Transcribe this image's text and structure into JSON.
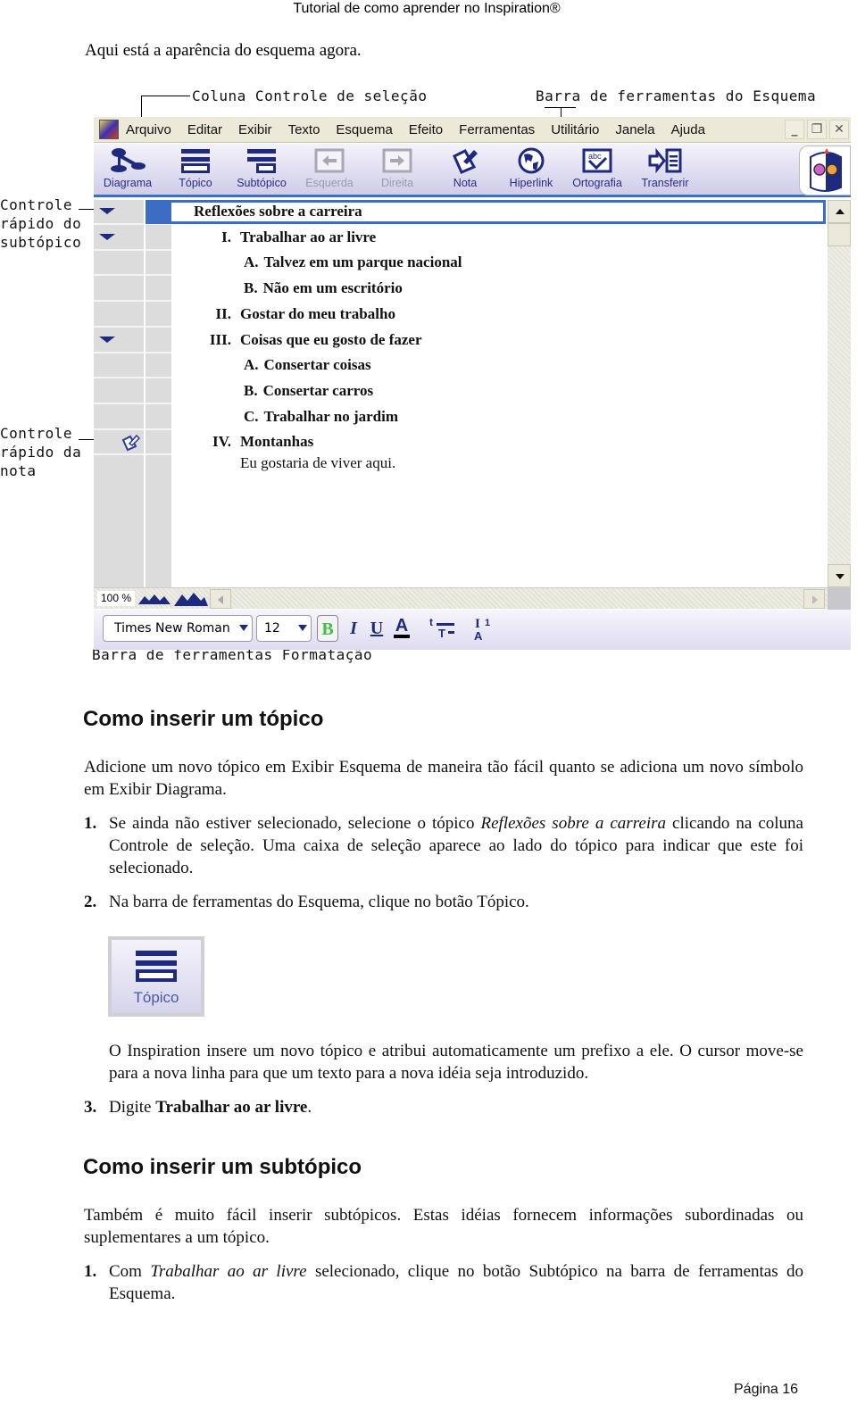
{
  "header": {
    "title": "Tutorial de como aprender no Inspiration®"
  },
  "intro": "Aqui está a aparência do esquema agora.",
  "figure": {
    "callouts": {
      "selection_column": "Coluna Controle de seleção",
      "outline_toolbar": "Barra de ferramentas do Esquema",
      "subtopic_quick_control": [
        "Controle",
        "rápido do",
        "subtópico"
      ],
      "note_quick_control": [
        "Controle",
        "rápido da",
        "nota"
      ],
      "formatting_toolbar": "Barra de ferramentas Formatação"
    },
    "app": {
      "menu": [
        "Arquivo",
        "Editar",
        "Exibir",
        "Texto",
        "Esquema",
        "Efeito",
        "Ferramentas",
        "Utilitário",
        "Janela",
        "Ajuda"
      ],
      "window_buttons": {
        "minimize": "_",
        "restore": "❐",
        "close": "✕"
      },
      "toolbar": [
        {
          "label": "Diagrama",
          "icon": "diagram-icon",
          "enabled": true
        },
        {
          "label": "Tópico",
          "icon": "topic-icon",
          "enabled": true
        },
        {
          "label": "Subtópico",
          "icon": "subtopic-icon",
          "enabled": true
        },
        {
          "label": "Esquerda",
          "icon": "arrow-left-icon",
          "enabled": false
        },
        {
          "label": "Direita",
          "icon": "arrow-right-icon",
          "enabled": false
        },
        {
          "label": "Nota",
          "icon": "note-icon",
          "enabled": true
        },
        {
          "label": "Hiperlink",
          "icon": "globe-icon",
          "enabled": true
        },
        {
          "label": "Ortografia",
          "icon": "spellcheck-icon",
          "enabled": true
        },
        {
          "label": "Transferir",
          "icon": "transfer-icon",
          "enabled": true
        }
      ],
      "outline": [
        {
          "prefix": "",
          "text": "Reflexões sobre a carreira",
          "level": 0,
          "selected": true,
          "control": "subtopic"
        },
        {
          "prefix": "I.",
          "text": "Trabalhar ao ar livre",
          "level": 1,
          "control": "subtopic"
        },
        {
          "prefix": "A.",
          "text": "Talvez em um parque nacional",
          "level": 2,
          "control": ""
        },
        {
          "prefix": "B.",
          "text": "Não em um escritório",
          "level": 2,
          "control": ""
        },
        {
          "prefix": "II.",
          "text": "Gostar do meu trabalho",
          "level": 1,
          "control": ""
        },
        {
          "prefix": "III.",
          "text": "Coisas que eu gosto de fazer",
          "level": 1,
          "control": "subtopic"
        },
        {
          "prefix": "A.",
          "text": "Consertar coisas",
          "level": 2,
          "control": ""
        },
        {
          "prefix": "B.",
          "text": "Consertar carros",
          "level": 2,
          "control": ""
        },
        {
          "prefix": "C.",
          "text": "Trabalhar no jardim",
          "level": 2,
          "control": ""
        },
        {
          "prefix": "IV.",
          "text": "Montanhas",
          "level": 1,
          "control": "note",
          "note": "Eu gostaria de viver aqui."
        }
      ],
      "zoom_level": "100 %",
      "format": {
        "font": "Times New Roman",
        "size": "12",
        "bold": "B",
        "italic": "I",
        "underline": "U",
        "text_color": "A",
        "superscript_glyph": "t",
        "subscript_glyph": "I",
        "accent_color": "#3b6dc4",
        "icon_color": "#1e2a80"
      }
    }
  },
  "section1": {
    "title": "Como inserir um tópico",
    "intro": "Adicione um novo tópico em Exibir Esquema de maneira tão fácil quanto se adiciona um novo símbolo em Exibir Diagrama.",
    "step1": {
      "num": "1.",
      "before": "Se ainda não estiver selecionado, selecione o tópico ",
      "italic": "Reflexões sobre a carreira",
      "after": " clicando na coluna Controle de seleção. Uma caixa de seleção aparece ao lado do tópico para indicar que este foi selecionado."
    },
    "step2": {
      "num": "2.",
      "text": "Na barra de ferramentas do Esquema, clique no botão Tópico."
    },
    "button_image_label": "Tópico",
    "result_text": "O Inspiration insere um novo tópico e atribui automaticamente um prefixo a ele. O cursor move-se para a nova linha para que um texto para a nova idéia seja introduzido.",
    "step3": {
      "num": "3.",
      "before": "Digite ",
      "bold": "Trabalhar ao ar livre",
      "after": "."
    }
  },
  "section2": {
    "title": "Como inserir um subtópico",
    "intro": "Também é muito fácil inserir subtópicos. Estas idéias fornecem informações subordinadas ou suplementares a um tópico.",
    "step1": {
      "num": "1.",
      "before": "Com ",
      "italic": "Trabalhar ao ar livre",
      "after": " selecionado, clique no botão Subtópico na barra de ferramentas do Esquema."
    }
  },
  "footer": {
    "page": "Página 16"
  }
}
